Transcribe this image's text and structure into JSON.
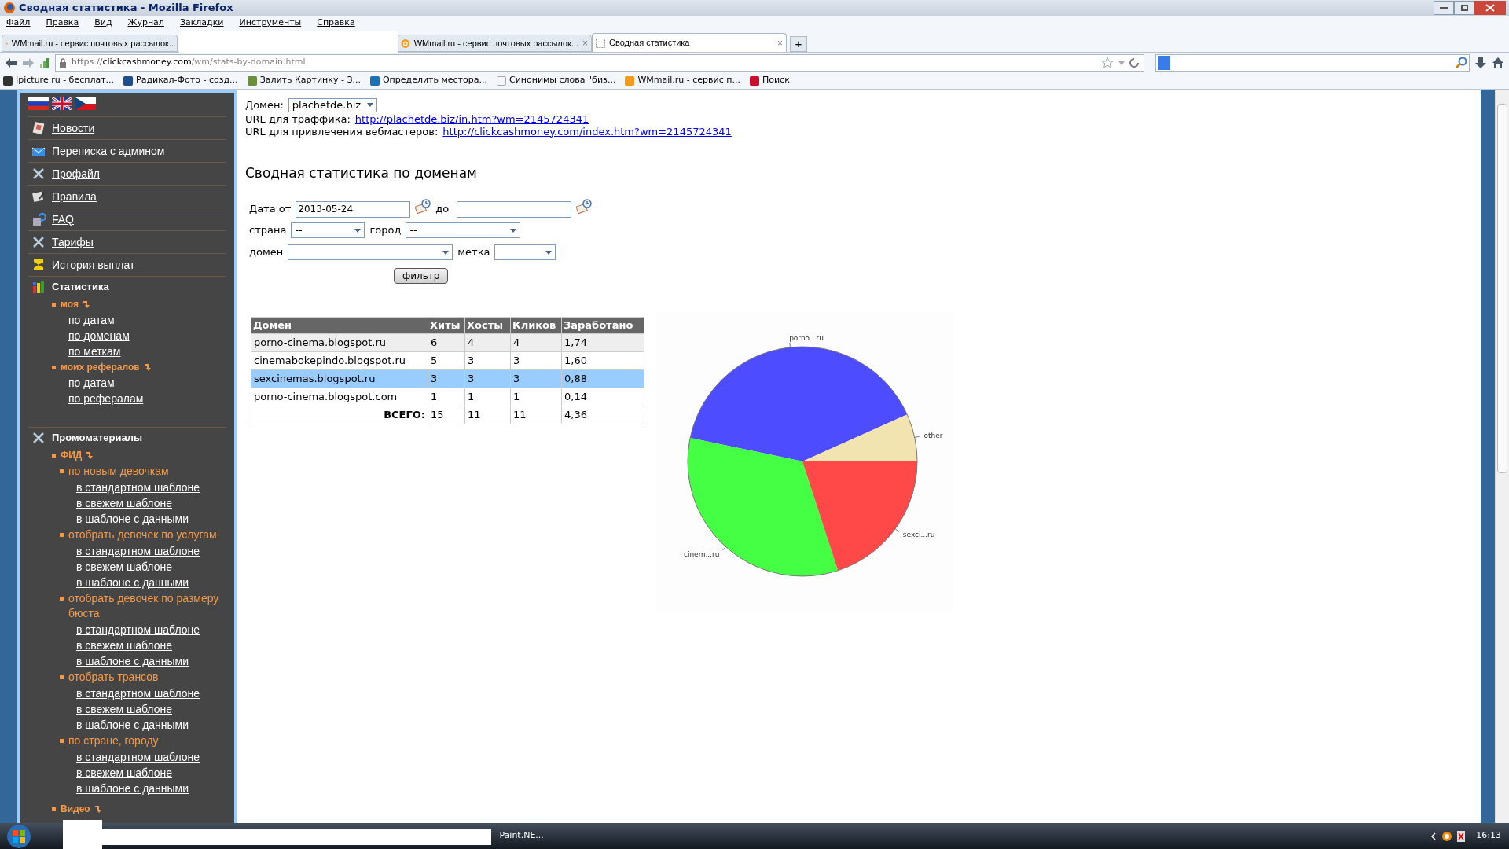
{
  "window": {
    "title": "Сводная статистика - Mozilla Firefox"
  },
  "menu_bar": [
    "Файл",
    "Правка",
    "Вид",
    "Журнал",
    "Закладки",
    "Инструменты",
    "Справка"
  ],
  "tabs": [
    {
      "label": "WMmail.ru - сервис почтовых рассылок..",
      "selected": false
    },
    {
      "label": "WMmail.ru - сервис почтовых рассылок...",
      "selected": false,
      "close": "×"
    },
    {
      "label": "Сводная статистика",
      "selected": true,
      "close": "×"
    }
  ],
  "new_tab": "+",
  "address_bar": {
    "scheme": "https://",
    "host": "clickcashmoney.com",
    "path": "/wm/stats-by-domain.html"
  },
  "bookmarks": [
    "Ipicture.ru - бесплат...",
    "Радикал-Фото - созд...",
    "Залить Картинку - З...",
    "Определить местора...",
    "Синонимы слова \"биз...",
    "WMmail.ru - сервис п...",
    "Поиск"
  ],
  "sidebar": {
    "items": [
      {
        "kind": "link",
        "label": "Новости"
      },
      {
        "kind": "link",
        "label": "Переписка с админом"
      },
      {
        "kind": "link",
        "label": "Профайл"
      },
      {
        "kind": "link",
        "label": "Правила"
      },
      {
        "kind": "link",
        "label": "FAQ"
      },
      {
        "kind": "link",
        "label": "Тарифы"
      },
      {
        "kind": "link",
        "label": "История выплат"
      },
      {
        "kind": "group",
        "label": "Статистика",
        "children": [
          {
            "kind": "group",
            "label": "моя",
            "children": [
              {
                "kind": "link",
                "label": "по датам"
              },
              {
                "kind": "link",
                "label": "по доменам"
              },
              {
                "kind": "link",
                "label": "по меткам"
              }
            ]
          },
          {
            "kind": "group",
            "label": "моих рефералов",
            "children": [
              {
                "kind": "link",
                "label": "по датам"
              },
              {
                "kind": "link",
                "label": "по рефералам"
              }
            ]
          }
        ]
      },
      {
        "kind": "group",
        "label": "Промоматериалы",
        "children": [
          {
            "kind": "group",
            "label": "ФИД",
            "children": [
              {
                "kind": "group",
                "label": "по новым девочкам",
                "children": [
                  {
                    "kind": "link",
                    "label": "в стандартном шаблоне"
                  },
                  {
                    "kind": "link",
                    "label": "в свежем шаблоне"
                  },
                  {
                    "kind": "link",
                    "label": "в шаблоне с данными"
                  }
                ]
              },
              {
                "kind": "group",
                "label": "отобрать девочек по услугам",
                "children": [
                  {
                    "kind": "link",
                    "label": "в стандартном шаблоне"
                  },
                  {
                    "kind": "link",
                    "label": "в свежем шаблоне"
                  },
                  {
                    "kind": "link",
                    "label": "в шаблоне с данными"
                  }
                ]
              },
              {
                "kind": "group",
                "label": "отобрать девочек по размеру бюста",
                "children": [
                  {
                    "kind": "link",
                    "label": "в стандартном шаблоне"
                  },
                  {
                    "kind": "link",
                    "label": "в свежем шаблоне"
                  },
                  {
                    "kind": "link",
                    "label": "в шаблоне с данными"
                  }
                ]
              },
              {
                "kind": "group",
                "label": "отобрать трансов",
                "children": [
                  {
                    "kind": "link",
                    "label": "в стандартном шаблоне"
                  },
                  {
                    "kind": "link",
                    "label": "в свежем шаблоне"
                  },
                  {
                    "kind": "link",
                    "label": "в шаблоне с данными"
                  }
                ]
              },
              {
                "kind": "group",
                "label": "по стране, городу",
                "children": [
                  {
                    "kind": "link",
                    "label": "в стандартном шаблоне"
                  },
                  {
                    "kind": "link",
                    "label": "в свежем шаблоне"
                  },
                  {
                    "kind": "link",
                    "label": "в шаблоне с данными"
                  }
                ]
              }
            ]
          },
          {
            "kind": "group",
            "label": "Видео"
          }
        ]
      }
    ]
  },
  "main": {
    "domain": {
      "label": "Домен:",
      "value": "plachetde.biz"
    },
    "links": [
      {
        "label": "URL для траффика:",
        "url": "http://plachetde.biz/in.htm?wm=2145724341"
      },
      {
        "label": "URL для привлечения вебмастеров:",
        "url": "http://clickcashmoney.com/index.htm?wm=2145724341"
      }
    ],
    "heading": "Сводная статистика по доменам",
    "filter": {
      "date_from_label": "Дата от",
      "date_from": "2013-05-24",
      "date_to_label": "до",
      "country_label": "страна",
      "country": "--",
      "city_label": "город",
      "city": "--",
      "domain_label": "домен",
      "tag_label": "метка",
      "button": "фильтр"
    },
    "table": {
      "columns": [
        "Домен",
        "Хиты",
        "Хосты",
        "Кликов",
        "Заработано"
      ],
      "rows": [
        {
          "cells": [
            "porno-cinema.blogspot.ru",
            "6",
            "4",
            "4",
            "1,74"
          ],
          "selected": false
        },
        {
          "cells": [
            "cinemabokepindo.blogspot.ru",
            "5",
            "3",
            "3",
            "1,60"
          ],
          "selected": false
        },
        {
          "cells": [
            "sexcinemas.blogspot.ru",
            "3",
            "3",
            "3",
            "0,88"
          ],
          "selected": true
        },
        {
          "cells": [
            "porno-cinema.blogspot.com",
            "1",
            "1",
            "1",
            "0,14"
          ],
          "selected": false
        }
      ],
      "total": {
        "label": "ВСЕГО:",
        "cells": [
          "15",
          "11",
          "11",
          "4,36"
        ]
      }
    },
    "chart": {
      "chart_data": {
        "type": "pie",
        "categories": [
          "porno...ru",
          "cinem...ru",
          "sexci...ru",
          "other"
        ],
        "values": [
          40,
          33.3,
          20,
          6.7
        ],
        "colors": [
          "#4d4dff",
          "#44ff44",
          "#ff4848",
          "#f2e4b0"
        ]
      }
    }
  },
  "taskbar": {
    "task": "- Paint.NE...",
    "clock": "16:13"
  }
}
